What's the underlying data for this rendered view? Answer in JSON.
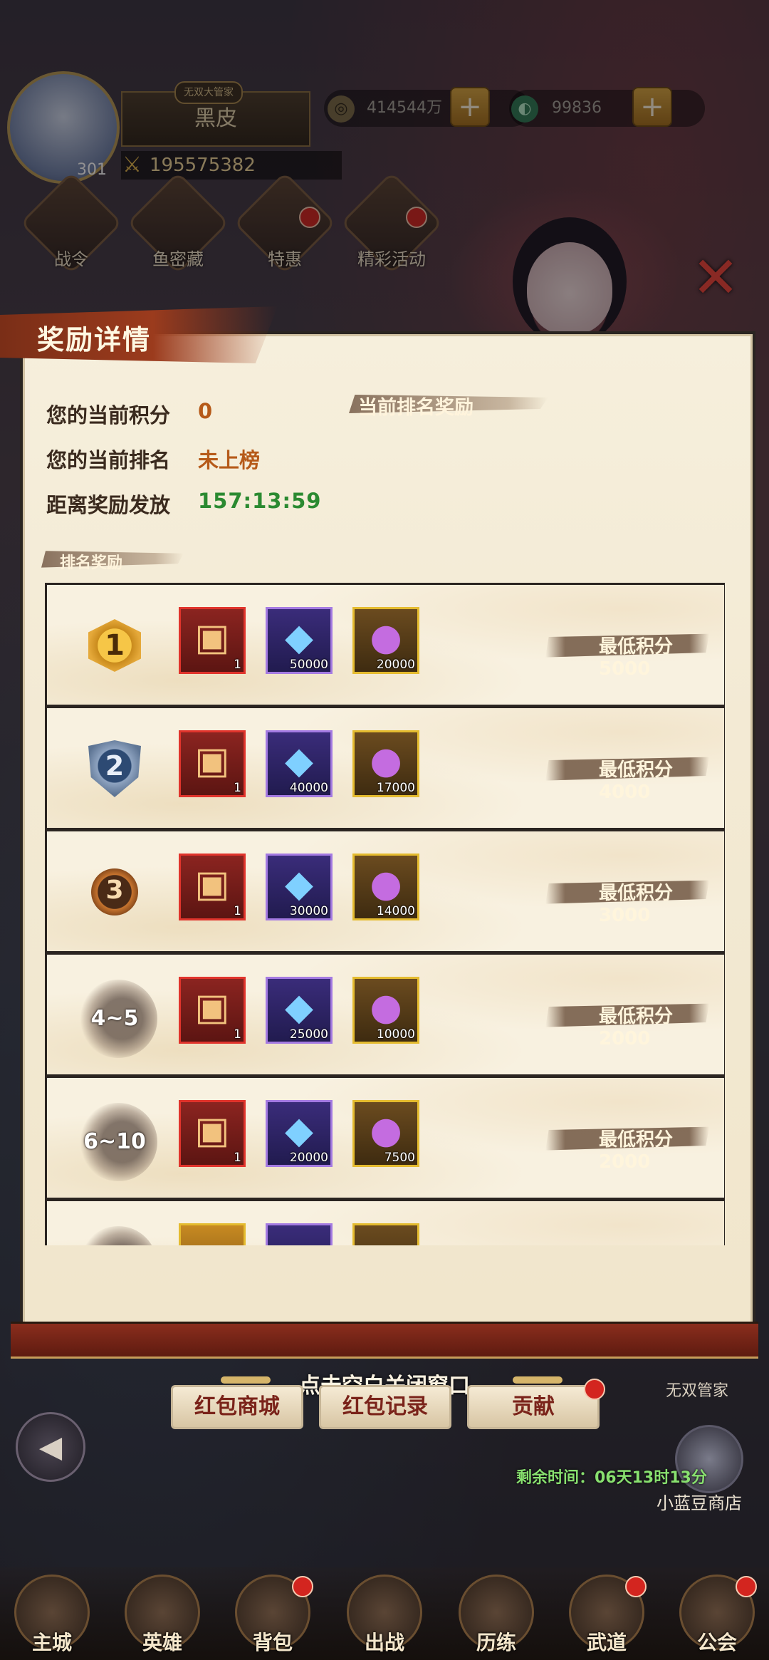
{
  "hud": {
    "player_name": "黑皮",
    "title_tag": "无双大管家",
    "level": "301",
    "power": "195575382",
    "coins": "414544万",
    "jade": "99836"
  },
  "top_icons": [
    "战令",
    "鱼密藏",
    "特惠",
    "精彩活动"
  ],
  "popup": {
    "title": "奖励详情",
    "current_score_label": "您的当前积分",
    "current_score_value": "0",
    "current_rank_label": "您的当前排名",
    "current_rank_value": "未上榜",
    "countdown_label": "距离奖励发放",
    "countdown_value": "157:13:59",
    "current_rank_reward_title": "当前排名奖励",
    "rank_reward_section_title": "排名奖励"
  },
  "rank_rewards": [
    {
      "rank": "1",
      "chest_qty": "1",
      "crystal_qty": "50000",
      "orb_qty": "20000",
      "min_score": "最低积分5000"
    },
    {
      "rank": "2",
      "chest_qty": "1",
      "crystal_qty": "40000",
      "orb_qty": "17000",
      "min_score": "最低积分4000"
    },
    {
      "rank": "3",
      "chest_qty": "1",
      "crystal_qty": "30000",
      "orb_qty": "14000",
      "min_score": "最低积分3000"
    },
    {
      "rank": "4~5",
      "chest_qty": "1",
      "crystal_qty": "25000",
      "orb_qty": "10000",
      "min_score": "最低积分2000"
    },
    {
      "rank": "6~10",
      "chest_qty": "1",
      "crystal_qty": "20000",
      "orb_qty": "7500",
      "min_score": "最低积分2000"
    }
  ],
  "bottom": {
    "close_hint": "点击空白关闭窗口",
    "buttons": [
      "红包商城",
      "红包记录",
      "贡献"
    ],
    "manager_label": "无双管家",
    "remaining_time": "剩余时间：06天13时13分",
    "shop_label": "小蓝豆商店"
  },
  "nav": [
    "主城",
    "英雄",
    "背包",
    "出战",
    "历练",
    "武道",
    "公会"
  ],
  "colors": {
    "accent_red": "#9b3b1d",
    "score_brown": "#b65a19",
    "countdown_green": "#2b8a31",
    "badge_red": "#d3251f"
  }
}
